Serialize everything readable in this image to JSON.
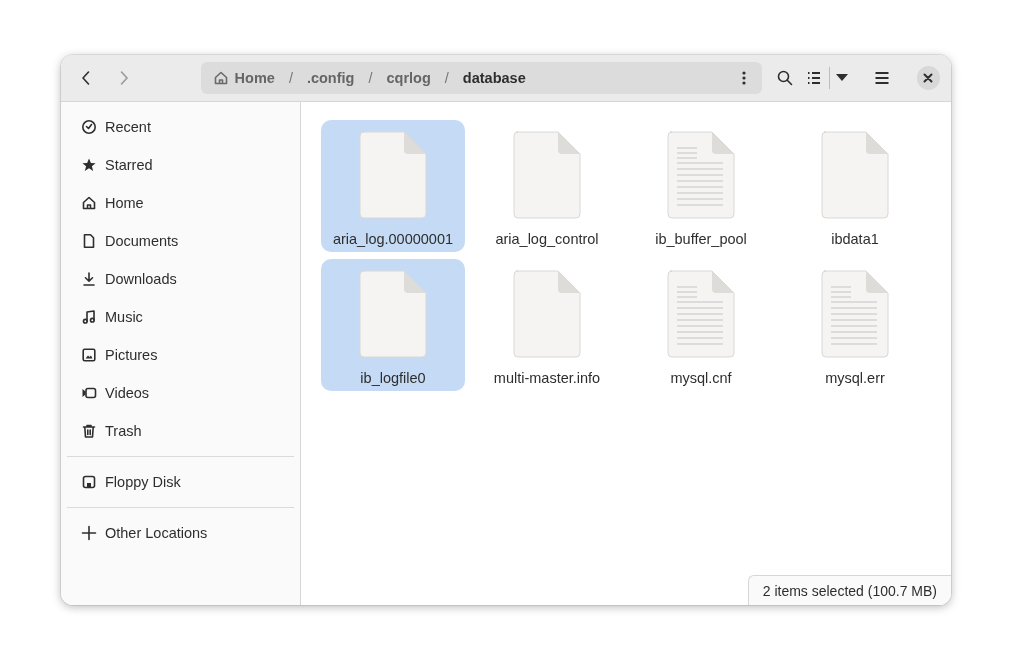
{
  "header": {
    "path": [
      {
        "label": "Home",
        "kind": "home",
        "current": false
      },
      {
        "label": ".config",
        "kind": "folder",
        "current": false
      },
      {
        "label": "cqrlog",
        "kind": "folder",
        "current": false
      },
      {
        "label": "database",
        "kind": "folder",
        "current": true
      }
    ],
    "separator": "/"
  },
  "sidebar": {
    "sections": [
      [
        {
          "label": "Recent",
          "kind": "recent"
        },
        {
          "label": "Starred",
          "kind": "starred"
        },
        {
          "label": "Home",
          "kind": "home"
        },
        {
          "label": "Documents",
          "kind": "documents"
        },
        {
          "label": "Downloads",
          "kind": "downloads"
        },
        {
          "label": "Music",
          "kind": "music"
        },
        {
          "label": "Pictures",
          "kind": "pictures"
        },
        {
          "label": "Videos",
          "kind": "videos"
        },
        {
          "label": "Trash",
          "kind": "trash"
        }
      ],
      [
        {
          "label": "Floppy Disk",
          "kind": "floppy"
        }
      ],
      [
        {
          "label": "Other Locations",
          "kind": "other"
        }
      ]
    ]
  },
  "files": [
    {
      "name": "aria_log.00000001",
      "kind": "blank",
      "selected": true
    },
    {
      "name": "aria_log_control",
      "kind": "blank",
      "selected": false
    },
    {
      "name": "ib_buffer_pool",
      "kind": "text",
      "selected": false
    },
    {
      "name": "ibdata1",
      "kind": "blank",
      "selected": false
    },
    {
      "name": "ib_logfile0",
      "kind": "blank",
      "selected": true
    },
    {
      "name": "multi-master.info",
      "kind": "blank",
      "selected": false
    },
    {
      "name": "mysql.cnf",
      "kind": "text",
      "selected": false
    },
    {
      "name": "mysql.err",
      "kind": "text",
      "selected": false
    }
  ],
  "status_bar": "2 items selected (100.7 MB)"
}
